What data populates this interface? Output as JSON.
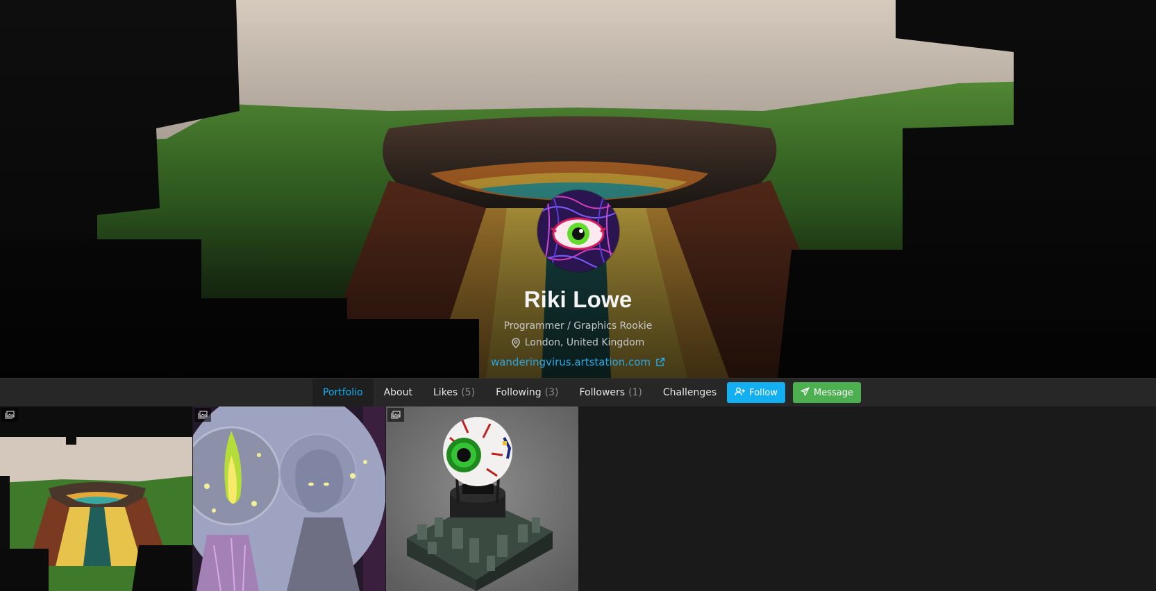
{
  "profile": {
    "name": "Riki Lowe",
    "headline": "Programmer / Graphics Rookie",
    "location": "London, United Kingdom",
    "website": "wanderingvirus.artstation.com"
  },
  "nav": {
    "tabs": [
      {
        "label": "Portfolio",
        "count": "",
        "active": true
      },
      {
        "label": "About",
        "count": ""
      },
      {
        "label": "Likes",
        "count": "(5)"
      },
      {
        "label": "Following",
        "count": "(3)"
      },
      {
        "label": "Followers",
        "count": "(1)"
      },
      {
        "label": "Challenges",
        "count": ""
      }
    ],
    "follow_label": "Follow",
    "message_label": "Message"
  },
  "colors": {
    "accent": "#13aff0",
    "follow": "#13aff0",
    "message": "#4caf50",
    "background": "#1a1a1a",
    "navbar": "#272727"
  },
  "icons": {
    "location": "map-pin-icon",
    "website": "external-link-icon",
    "follow": "user-plus-icon",
    "message": "paper-plane-icon",
    "tile_badge": "images-icon"
  }
}
